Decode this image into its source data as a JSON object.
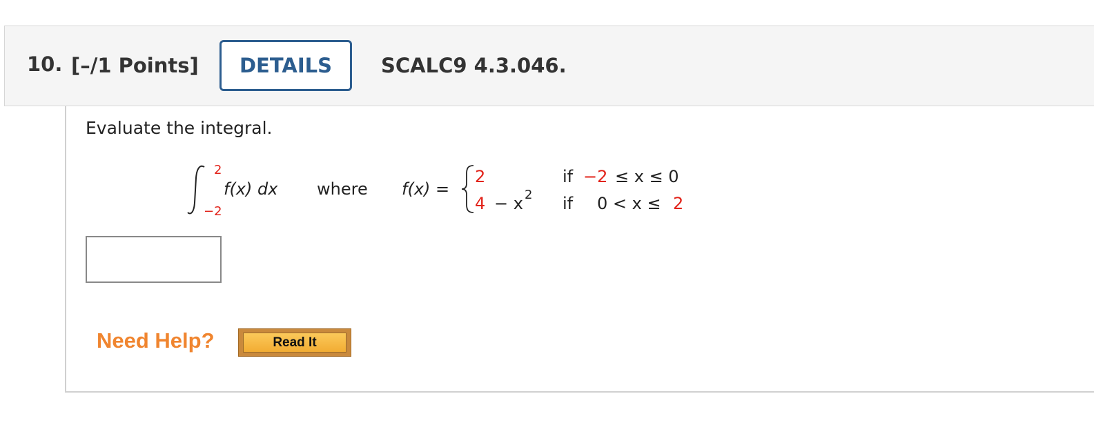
{
  "header": {
    "question_number": "10.",
    "points": "[–/1 Points]",
    "details_label": "DETAILS",
    "question_id": "SCALC9 4.3.046."
  },
  "question": {
    "prompt": "Evaluate the integral.",
    "integral_upper": "2",
    "integral_lower": "−2",
    "integrand": "f(x) dx",
    "where": "where",
    "fx_label": "f(x) =",
    "case1_value": "2",
    "case1_condition_if": "if",
    "case1_condition_low": "−2",
    "case1_condition_rest": "≤ x ≤ 0",
    "case2_value_num": "4",
    "case2_value_rest": "− x",
    "case2_exp": "2",
    "case2_condition_if": "if",
    "case2_condition_rest": "0 < x ≤",
    "case2_condition_high": "2"
  },
  "answer": {
    "value": ""
  },
  "help": {
    "need_help_label": "Need Help?",
    "read_it_label": "Read It"
  },
  "colors": {
    "accent_blue": "#2c5d8f",
    "red": "#e2231a",
    "need_help_orange": "#f0852f"
  }
}
